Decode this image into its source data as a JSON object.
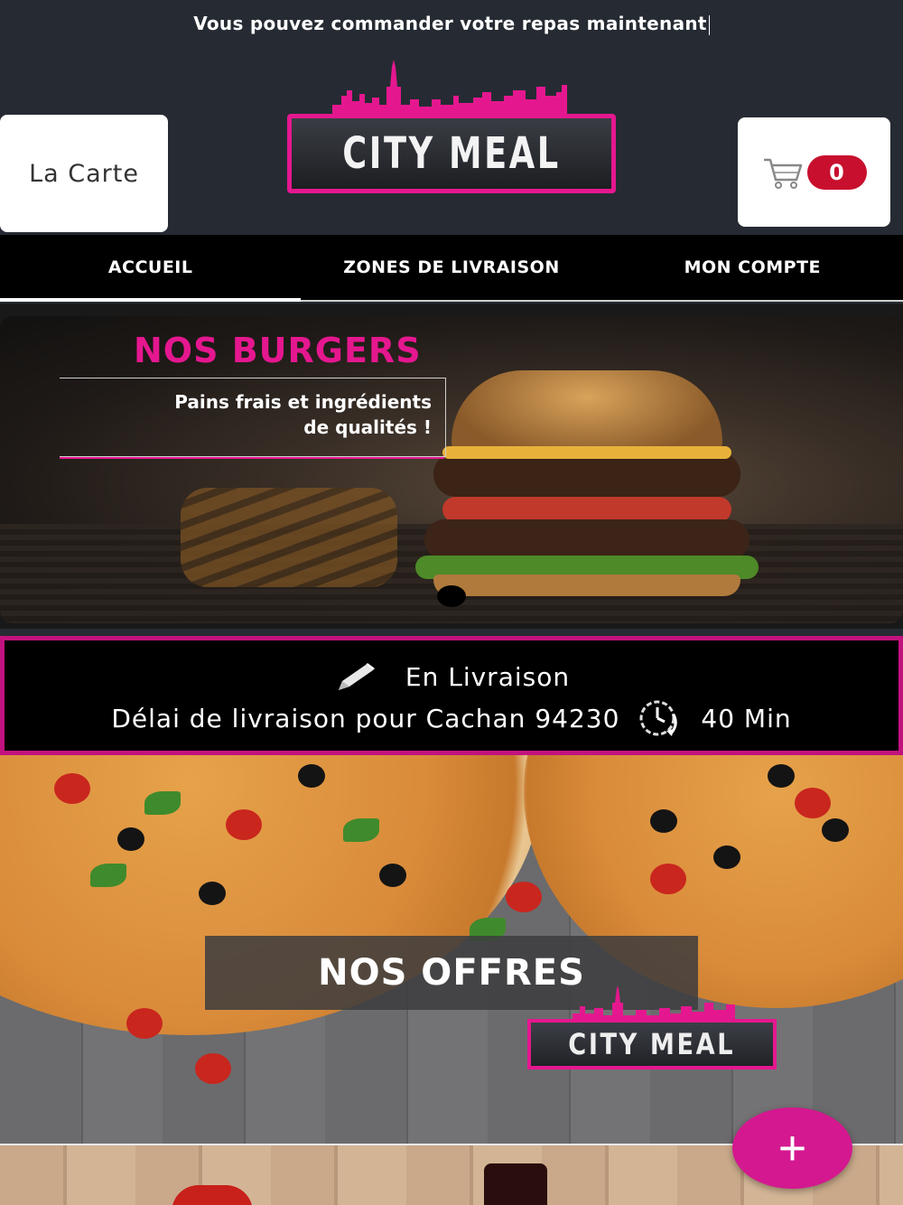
{
  "announcement": "Vous pouvez commander votre repas maintenant",
  "header": {
    "menu_button": "La Carte",
    "logo_text": "CITY MEAL",
    "cart_count": "0",
    "cart_icon": "cart-icon"
  },
  "nav": {
    "tabs": [
      {
        "label": "ACCUEIL",
        "active": true
      },
      {
        "label": "ZONES DE LIVRAISON",
        "active": false
      },
      {
        "label": "MON COMPTE",
        "active": false
      }
    ]
  },
  "banner": {
    "title": "NOS BURGERS",
    "tagline_line1": "Pains frais et ingrédients",
    "tagline_line2": "de qualités !",
    "slide_count": 1,
    "active_slide": 1
  },
  "delivery": {
    "mode": "En Livraison",
    "delay_label": "Délai de livraison pour Cachan 94230",
    "delay_value": "40 Min",
    "mode_icon": "pencil-icon",
    "delay_icon": "clock-icon"
  },
  "offers": {
    "title": "NOS OFFRES",
    "logo_text": "CITY MEAL"
  },
  "fab": {
    "label": "+",
    "icon": "plus-icon"
  },
  "colors": {
    "accent": "#e5178f",
    "header_bg": "#262b33",
    "badge": "#c8102e",
    "nav_bg": "#000000"
  }
}
